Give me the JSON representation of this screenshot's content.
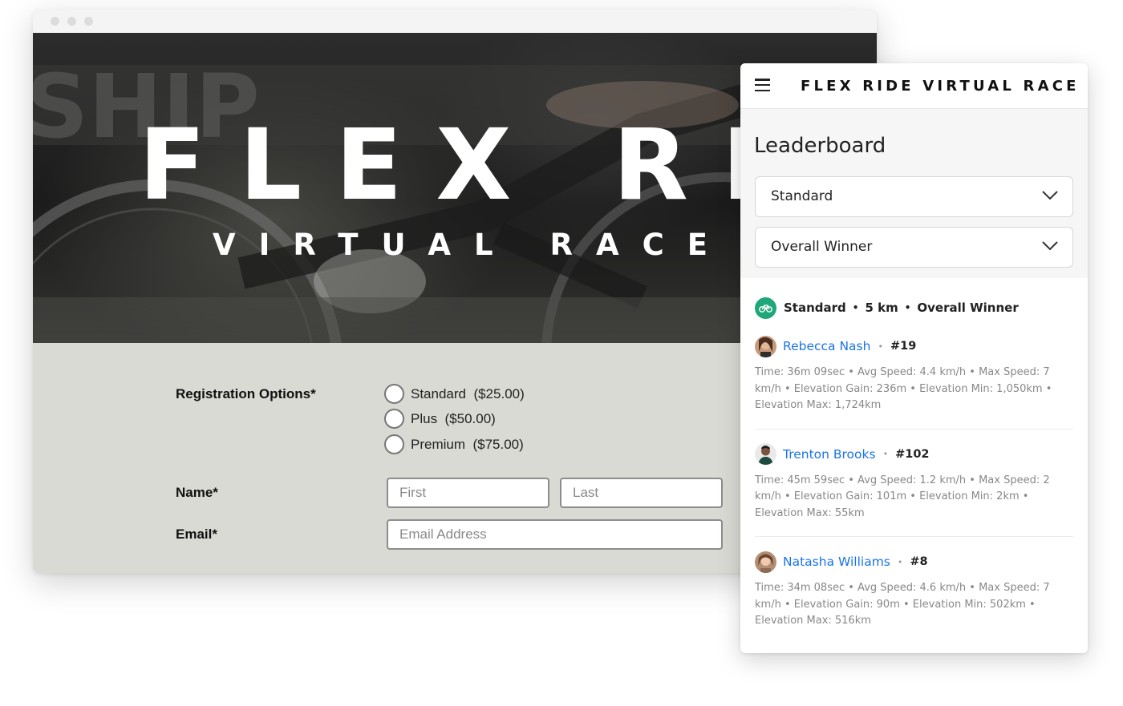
{
  "hero": {
    "title": "FLEX RIDE",
    "subtitle": "VIRTUAL RACE"
  },
  "form": {
    "registration_label": "Registration Options*",
    "options": [
      {
        "label": "Standard  ($25.00)"
      },
      {
        "label": "Plus  ($50.00)"
      },
      {
        "label": "Premium  ($75.00)"
      }
    ],
    "name_label": "Name*",
    "first_placeholder": "First",
    "last_placeholder": "Last",
    "email_label": "Email*",
    "email_placeholder": "Email Address"
  },
  "panel": {
    "brand": "FLEX RIDE VIRTUAL RACE",
    "title": "Leaderboard",
    "filters": [
      "Standard",
      "Overall Winner"
    ],
    "summary": {
      "category": "Standard",
      "distance": "5 km",
      "award": "Overall Winner"
    },
    "racers": [
      {
        "name": "Rebecca Nash",
        "rank": "#19",
        "stats": "Time: 36m 09sec  •  Avg Speed: 4.4 km/h  •  Max Speed: 7 km/h  •  Elevation Gain:  236m  •  Elevation Min: 1,050km  •  Elevation Max: 1,724km"
      },
      {
        "name": "Trenton Brooks",
        "rank": "#102",
        "stats": "Time: 45m 59sec  •  Avg Speed:  1.2 km/h  •  Max Speed: 2 km/h  •  Elevation Gain: 101m  •  Elevation Min: 2km  •  Elevation Max: 55km"
      },
      {
        "name": "Natasha Williams",
        "rank": "#8",
        "stats": "Time: 34m 08sec  •  Avg Speed: 4.6 km/h  •  Max Speed: 7 km/h  •  Elevation Gain:  90m  •  Elevation Min: 502km  •  Elevation Max: 516km"
      }
    ]
  },
  "colors": {
    "form_background": "#d8dad3",
    "link_blue": "#1a73e8",
    "badge_green": "#1fa67a"
  }
}
